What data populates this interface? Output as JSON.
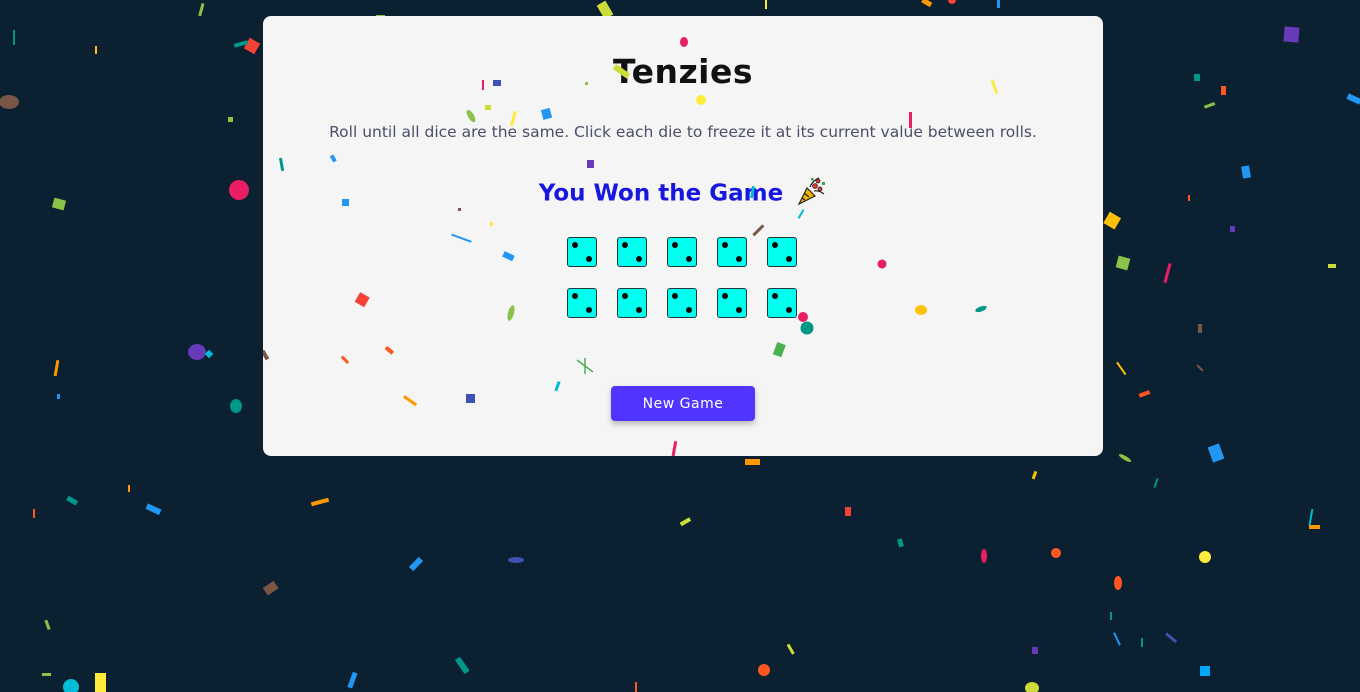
{
  "game": {
    "title": "Tenzies",
    "instructions": "Roll until all dice are the same. Click each die to freeze it at its current value between rolls.",
    "status_message": "You Won the Game",
    "status_icon": "party-popper-icon",
    "new_game_label": "New Game"
  },
  "dice": [
    {
      "value": 2,
      "held": true
    },
    {
      "value": 2,
      "held": true
    },
    {
      "value": 2,
      "held": true
    },
    {
      "value": 2,
      "held": true
    },
    {
      "value": 2,
      "held": true
    },
    {
      "value": 2,
      "held": true
    },
    {
      "value": 2,
      "held": true
    },
    {
      "value": 2,
      "held": true
    },
    {
      "value": 2,
      "held": true
    },
    {
      "value": 2,
      "held": true
    }
  ],
  "colors": {
    "background": "#0b2030",
    "card": "#f5f5f5",
    "held_die": "#00ffee",
    "win_text": "#1717e0",
    "button": "#5035ff"
  }
}
